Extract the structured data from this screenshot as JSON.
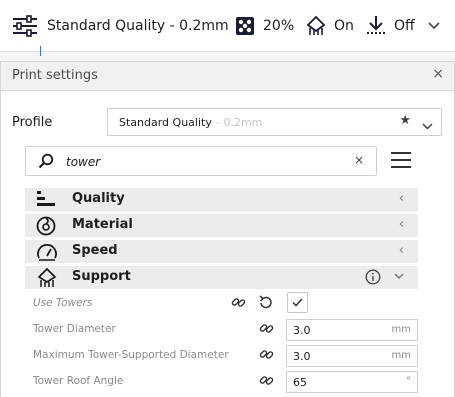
{
  "topbar": {
    "profile_label": "Standard Quality - 0.2mm",
    "infill_value": "20%",
    "support_value": "On",
    "adhesion_value": "Off",
    "icons": [
      "sliders-icon",
      "infill-icon",
      "support-icon",
      "adhesion-icon",
      "chevron-down-icon"
    ]
  },
  "panel": {
    "title": "Print settings",
    "close": "×"
  },
  "profile": {
    "label": "Profile",
    "name": "Standard Quality",
    "sub": "- 0.2mm",
    "star": "★"
  },
  "search": {
    "value": "tower",
    "clear": "×"
  },
  "categories": [
    {
      "label": "Quality",
      "icon": "quality-icon",
      "chevron": "‹"
    },
    {
      "label": "Material",
      "icon": "material-icon",
      "chevron": "‹"
    },
    {
      "label": "Speed",
      "icon": "speed-icon",
      "chevron": "‹"
    },
    {
      "label": "Support",
      "icon": "support-icon",
      "chevron": "⌄"
    }
  ],
  "settings": [
    {
      "label": "Use Towers",
      "checked": true
    },
    {
      "label": "Tower Diameter",
      "value": "3.0",
      "unit": "mm"
    },
    {
      "label": "Maximum Tower-Supported Diameter",
      "value": "3.0",
      "unit": "mm"
    },
    {
      "label": "Tower Roof Angle",
      "value": "65",
      "unit": "°"
    }
  ],
  "colors": {
    "accent": "#3a6fd8",
    "category_bg": "#ececec",
    "panel_header": "#f1f1f1"
  }
}
